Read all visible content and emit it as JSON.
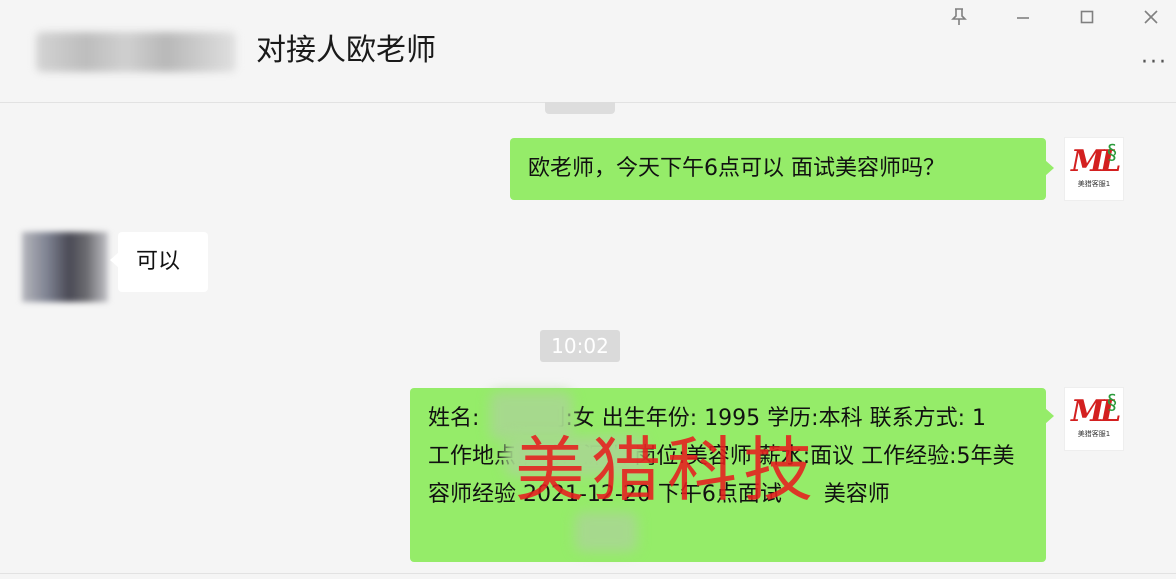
{
  "header": {
    "title": "对接人欧老师",
    "more_label": "···",
    "pin_icon": "pin-icon",
    "minimize_icon": "minimize-icon",
    "maximize_icon": "maximize-icon",
    "close_icon": "close-icon"
  },
  "messages": [
    {
      "from": "self",
      "text": "欧老师，今天下午6点可以 面试美容师吗？"
    },
    {
      "from": "other",
      "text": "可以"
    },
    {
      "from": "self",
      "text": "姓名:      性别:女 出生年份: 1995 学历:本科 联系方式: 1           工作地点:广东--深圳 岗位:美容师 薪水:面议 工作经验:5年美容师经验 2021-12-20 下午6点面试      美容师"
    }
  ],
  "timestamp": "10:02",
  "self_avatar": {
    "brand": "ML",
    "caption": "美猎客服1"
  },
  "watermark": "美猎科技",
  "colors": {
    "self_bubble": "#95ec69",
    "other_bubble": "#ffffff",
    "background": "#f5f5f5",
    "watermark": "#e61e1e"
  }
}
